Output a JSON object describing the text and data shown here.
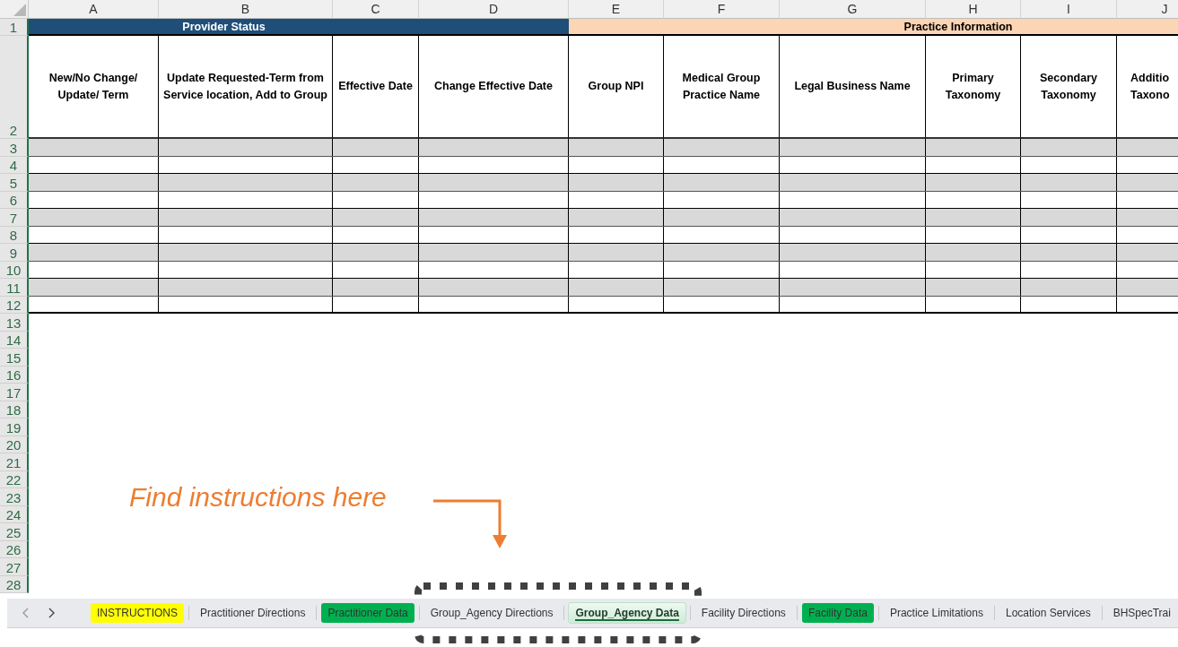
{
  "column_headers": [
    "A",
    "B",
    "C",
    "D",
    "E",
    "F",
    "G",
    "H",
    "I",
    "J"
  ],
  "group_headers": [
    {
      "label": "Provider Status",
      "color": "#1f4e78"
    },
    {
      "color": "#1f4e78"
    },
    {
      "label": "Practice Information",
      "color": "#fcd5b4"
    }
  ],
  "field_headers": [
    "New/No Change/\nUpdate/ Term",
    "Update Requested-Term from\nService location, Add to Group",
    "Effective Date",
    "Change Effective Date",
    "Group NPI",
    "Medical Group\nPractice Name",
    "Legal Business Name",
    "Primary\nTaxonomy",
    "Secondary\nTaxonomy",
    "Additio\nTaxono"
  ],
  "header_rows": [
    "1",
    "2"
  ],
  "data_rows": [
    {
      "number": "3",
      "shaded": true
    },
    {
      "number": "4",
      "shaded": false
    },
    {
      "number": "5",
      "shaded": true
    },
    {
      "number": "6",
      "shaded": false
    },
    {
      "number": "7",
      "shaded": true
    },
    {
      "number": "8",
      "shaded": false
    },
    {
      "number": "9",
      "shaded": true
    },
    {
      "number": "10",
      "shaded": false
    },
    {
      "number": "11",
      "shaded": true
    },
    {
      "number": "12",
      "shaded": false
    }
  ],
  "empty_rows": [
    "13",
    "14",
    "15",
    "16",
    "17",
    "18",
    "19",
    "20",
    "21",
    "22",
    "23",
    "24",
    "25",
    "26",
    "27",
    "28"
  ],
  "sheet_tabs": [
    {
      "label": "INSTRUCTIONS",
      "selected": false,
      "color": "#ffff00"
    },
    {
      "label": "Practitioner Directions",
      "selected": false
    },
    {
      "label": "Practitioner Data",
      "selected": false,
      "color": "#00b050"
    },
    {
      "label": "Group_Agency Directions",
      "selected": false
    },
    {
      "label": "Group_Agency Data",
      "selected": true
    },
    {
      "label": "Facility Directions",
      "selected": false
    },
    {
      "label": "Facility Data",
      "selected": false,
      "color": "#00b050"
    },
    {
      "label": "Practice Limitations",
      "selected": false
    },
    {
      "label": "Location Services",
      "selected": false
    },
    {
      "label": "BHSpecTrai",
      "selected": false
    }
  ],
  "annotation": {
    "text": "Find instructions here"
  }
}
